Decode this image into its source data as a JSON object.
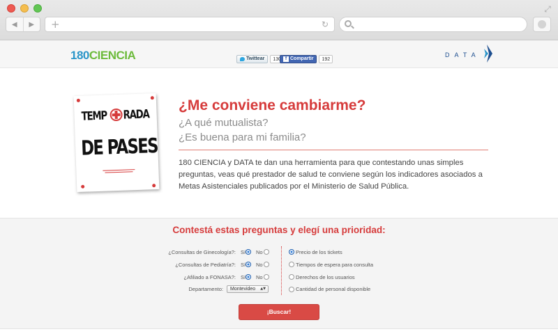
{
  "browser": {
    "back_glyph": "◀",
    "forward_glyph": "▶",
    "new_tab_glyph": "+",
    "reload_glyph": "↻",
    "expand_glyph": "⤢",
    "url": "",
    "search_value": ""
  },
  "header": {
    "logo_number": "180",
    "logo_word": "CIENCIA",
    "twitter": {
      "label": "Twittear",
      "count": "130"
    },
    "facebook": {
      "label": "Compartir",
      "count": "192"
    },
    "data_logo": "DATA",
    "colors": {
      "logo_blue": "#2c96c9",
      "logo_green": "#6dbb3c",
      "data_blue": "#1d4e8f"
    }
  },
  "poster": {
    "line1a": "TEMP",
    "line1b": "RADA",
    "line2": "DE PASES"
  },
  "hero": {
    "title": "¿Me conviene cambiarme?",
    "subtitle1": "¿A qué mutualista?",
    "subtitle2": "¿Es buena para mi familia?",
    "body": "180 CIENCIA y DATA te dan una herramienta para que contestando unas simples preguntas, veas qué prestador de salud te conviene según los indicadores asociados a Metas Asistenciales publicados por el Ministerio de Salud Pública."
  },
  "form": {
    "title": "Contestá estas preguntas y elegí una prioridad:",
    "questions": [
      {
        "label": "¿Consultas de Ginecología?:",
        "yes": "Sí",
        "no": "No",
        "selected": "yes"
      },
      {
        "label": "¿Consultas de Pediatría?:",
        "yes": "Sí",
        "no": "No",
        "selected": "yes"
      },
      {
        "label": "¿Afiliado a FONASA?:",
        "yes": "Sí",
        "no": "No",
        "selected": "yes"
      }
    ],
    "department": {
      "label": "Departamento:",
      "value": "Montevideo",
      "arrow": "▲▼"
    },
    "priorities": [
      {
        "label": "Precio de los tickets",
        "selected": true
      },
      {
        "label": "Tiempos de espera para consulta",
        "selected": false
      },
      {
        "label": "Derechos de los usuarios",
        "selected": false
      },
      {
        "label": "Cantidad de personal disponible",
        "selected": false
      }
    ],
    "submit": "¡Buscar!",
    "accent": "#d63b3b"
  }
}
